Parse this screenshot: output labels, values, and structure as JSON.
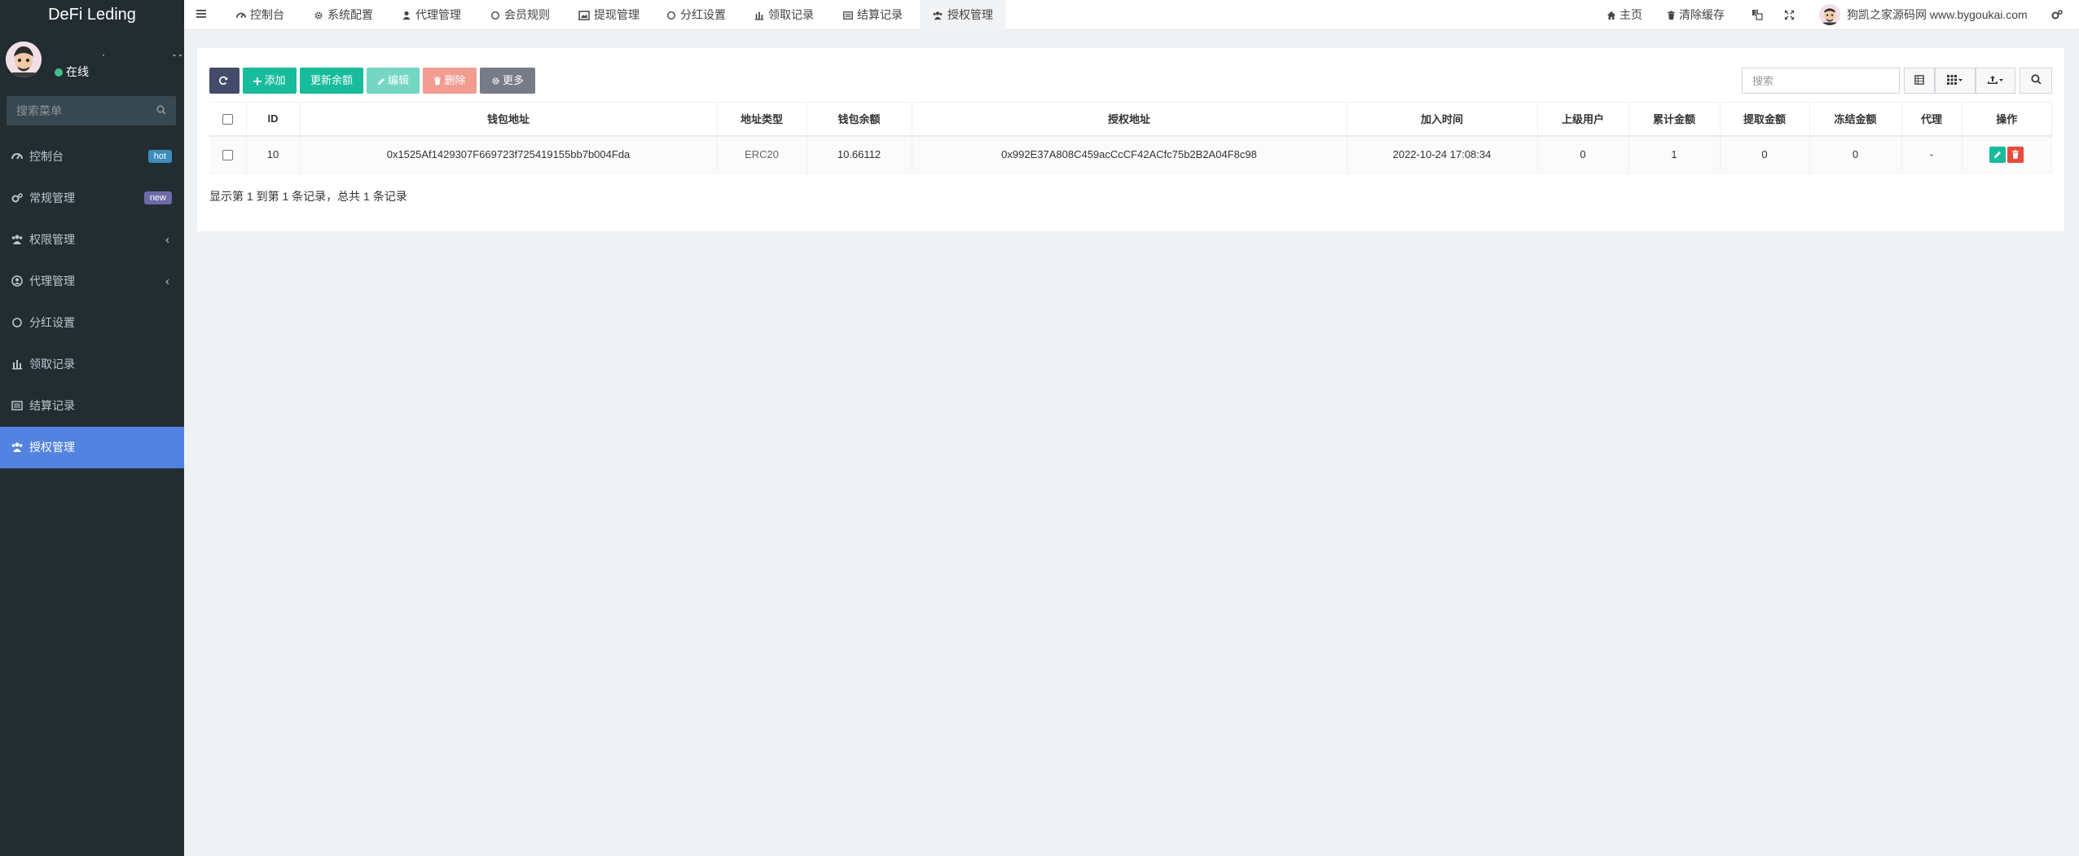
{
  "app": {
    "title": "DeFi Leding"
  },
  "user": {
    "status": "在线"
  },
  "sidebar": {
    "search_placeholder": "搜索菜单",
    "items": [
      {
        "label": "控制台",
        "icon": "dashboard-icon",
        "badge": "hot"
      },
      {
        "label": "常规管理",
        "icon": "cogs-icon",
        "badge": "new"
      },
      {
        "label": "权限管理",
        "icon": "group-icon",
        "chevron": "‹"
      },
      {
        "label": "代理管理",
        "icon": "user-circle-icon",
        "chevron": "‹"
      },
      {
        "label": "分红设置",
        "icon": "circle-icon"
      },
      {
        "label": "领取记录",
        "icon": "bar-chart-icon"
      },
      {
        "label": "结算记录",
        "icon": "list-alt-icon"
      },
      {
        "label": "授权管理",
        "icon": "users-icon",
        "active": true
      }
    ]
  },
  "topnav": {
    "tabs": [
      {
        "label": "控制台",
        "icon": "dashboard-icon"
      },
      {
        "label": "系统配置",
        "icon": "gear-icon"
      },
      {
        "label": "代理管理",
        "icon": "user-icon"
      },
      {
        "label": "会员规则",
        "icon": "circle-icon"
      },
      {
        "label": "提现管理",
        "icon": "image-icon"
      },
      {
        "label": "分红设置",
        "icon": "circle-icon"
      },
      {
        "label": "领取记录",
        "icon": "bar-chart-icon"
      },
      {
        "label": "结算记录",
        "icon": "list-alt-icon"
      },
      {
        "label": "授权管理",
        "icon": "users-icon",
        "active": true
      }
    ],
    "home": "主页",
    "clear_cache": "清除缓存",
    "site_name": "狗凯之家源码网 www.bygoukai.com"
  },
  "toolbar": {
    "add": "添加",
    "update_balance": "更新余额",
    "edit": "编辑",
    "delete": "删除",
    "more": "更多",
    "search_placeholder": "搜索"
  },
  "table": {
    "headers": [
      "ID",
      "钱包地址",
      "地址类型",
      "钱包余额",
      "授权地址",
      "加入时间",
      "上级用户",
      "累计金额",
      "提取金额",
      "冻结金额",
      "代理",
      "操作"
    ],
    "rows": [
      {
        "id": "10",
        "wallet": "0x1525Af1429307F669723f725419155bb7b004Fda",
        "type": "ERC20",
        "balance": "10.66112",
        "auth_address": "0x992E37A808C459acCcCF42ACfc75b2B2A04F8c98",
        "join_time": "2022-10-24 17:08:34",
        "parent": "0",
        "total": "1",
        "withdrawn": "0",
        "frozen": "0",
        "agent": "-"
      }
    ]
  },
  "pagination": {
    "info": "显示第 1 到第 1 条记录，总共 1 条记录"
  },
  "colors": {
    "sidebar_bg": "#222d32",
    "active": "#5283e0",
    "success": "#18bc9c",
    "danger": "#e74c3c"
  }
}
